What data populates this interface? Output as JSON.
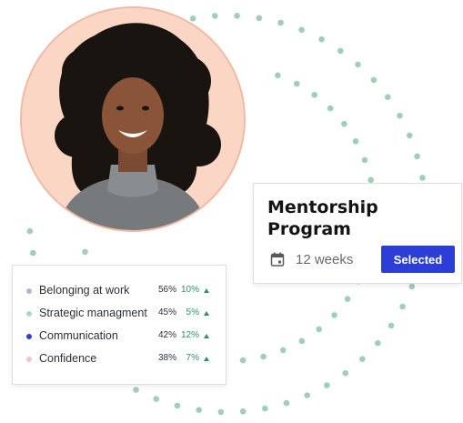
{
  "colors": {
    "dot": "#9fcfb9",
    "accent": "#2c3ed6",
    "avatar_bg": "#fbd6c5",
    "positive": "#2e8f6a"
  },
  "avatar": {
    "icon": "person-photo"
  },
  "program_card": {
    "title": "Mentorship Program",
    "duration": "12 weeks",
    "duration_icon": "calendar-icon",
    "button_label": "Selected"
  },
  "skills": [
    {
      "label": "Belonging at work",
      "score": "56%",
      "change": "10%",
      "dot_color": "#b9b4de",
      "trend_icon": "up-arrow"
    },
    {
      "label": "Strategic managment",
      "score": "45%",
      "change": "5%",
      "dot_color": "#a9d9c6",
      "trend_icon": "up-arrow"
    },
    {
      "label": "Communication",
      "score": "42%",
      "change": "12%",
      "dot_color": "#3340c9",
      "trend_icon": "up-arrow"
    },
    {
      "label": "Confidence",
      "score": "38%",
      "change": "7%",
      "dot_color": "#f2c4c8",
      "trend_icon": "up-arrow"
    }
  ]
}
